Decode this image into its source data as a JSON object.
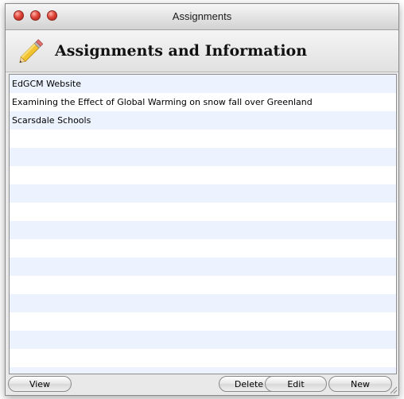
{
  "window": {
    "title": "Assignments"
  },
  "header": {
    "title": "Assignments and Information",
    "icon": "pencil-icon"
  },
  "list": {
    "items": [
      {
        "label": "EdGCM Website"
      },
      {
        "label": "Examining the Effect of Global Warming on snow fall over Greenland"
      },
      {
        "label": "Scarsdale Schools"
      }
    ],
    "stripe_color": "#edf3fe"
  },
  "buttons": {
    "view": "View",
    "delete": "Delete",
    "edit": "Edit",
    "new": "New"
  }
}
